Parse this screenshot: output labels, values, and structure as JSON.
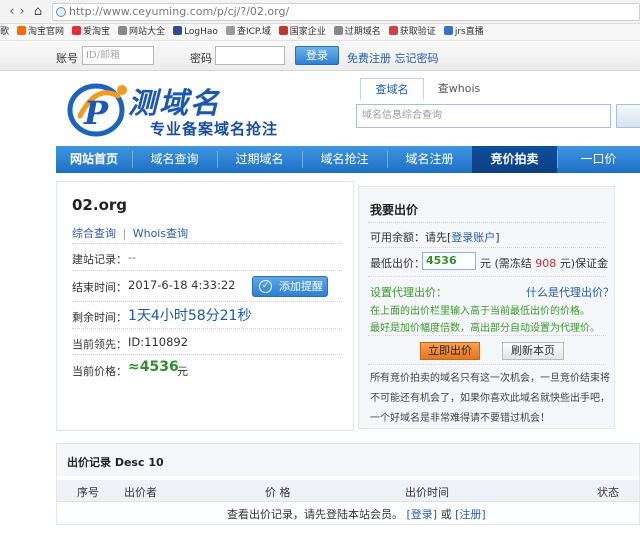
{
  "browser": {
    "url": "http://www.ceyuming.com/p/cj/?/02.org/",
    "bookmarks": [
      {
        "label": "歌",
        "color": "#e0b23c"
      },
      {
        "label": "淘宝官网",
        "color": "#ff6a00"
      },
      {
        "label": "爱淘宝",
        "color": "#e02f2f"
      },
      {
        "label": "网站大全",
        "color": "#888888"
      },
      {
        "label": "LogHao",
        "color": "#2a4f8f"
      },
      {
        "label": "查ICP.域",
        "color": "#9a9a9a"
      },
      {
        "label": "国家企业",
        "color": "#c0392b"
      },
      {
        "label": "过期域名",
        "color": "#888888"
      },
      {
        "label": "获取验证",
        "color": "#d04040"
      },
      {
        "label": "jrs直播",
        "color": "#3b6fd0"
      }
    ]
  },
  "login": {
    "account_label": "账号",
    "account_placeholder": "ID/邮箱",
    "password_label": "密码",
    "login_button": "登录",
    "register_link": "免费注册 忘记密码"
  },
  "header": {
    "logo_title": "测域名",
    "logo_subtitle": "专业备案域名抢注",
    "search_tabs": [
      "查域名",
      "查whois"
    ],
    "search_placeholder": "域名信息综合查询"
  },
  "nav": {
    "items": [
      "网站首页",
      "域名查询",
      "过期域名",
      "域名抢注",
      "域名注册",
      "竞价拍卖",
      "一口价"
    ],
    "active_index": 5
  },
  "auction": {
    "domain": "02.org",
    "links": [
      "综合查询",
      "Whois查询"
    ],
    "link_sep": "|",
    "build_label": "建站记录：",
    "build_value": "--",
    "end_label": "结束时间：",
    "end_value": "2017-6-18 4:33:22",
    "remind_button": "添加提醒",
    "remain_label": "剩余时间：",
    "remain_value": "1天4小时58分21秒",
    "leader_label": "当前领先：",
    "leader_value": "ID:110892",
    "price_label": "当前价格：",
    "price_value": "≈4536",
    "price_unit": "元"
  },
  "bid": {
    "title": "我要出价",
    "balance_label": "可用余额：请先[",
    "balance_link": "登录账户",
    "balance_end": "]",
    "min_label": "最低出价：",
    "min_value": "4536",
    "min_unit": "元 (需冻结",
    "freeze_value": "908",
    "freeze_end": "元)保证金",
    "proxy_label": "设置代理出价：",
    "proxy_help": "什么是代理出价？",
    "proxy_tip_1": "在上面的出价栏里输入高于当前最低出价的价格。",
    "proxy_tip_2": "最好是加价幅度倍数，高出部分自动设置为代理价。",
    "bid_button": "立即出价",
    "refresh_button": "刷新本页",
    "notice_1": "所有竞价拍卖的域名只有这一次机会，一旦竞价结束将",
    "notice_2": "不可能还有机会了，如果你喜欢此域名就快些出手吧，",
    "notice_3": "一个好域名是非常难得请不要错过机会！"
  },
  "records": {
    "title": "出价记录 Desc 10",
    "columns": [
      "序号",
      "出价者",
      "价 格",
      "出价时间",
      "状态"
    ],
    "empty_text": "查看出价记录，请先登陆本站会员。",
    "login_link": "[登录]",
    "or_text": "或",
    "register_link": "[注册]"
  },
  "colors": {
    "nav_blue": "#2a7fd0",
    "nav_active": "#0d4a94",
    "price_green": "#2d8f2d",
    "freeze_red": "#d62b2b",
    "proxy_green": "#3a9a2a"
  }
}
